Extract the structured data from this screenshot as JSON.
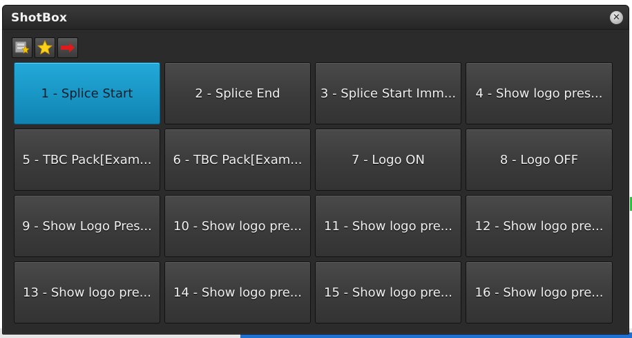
{
  "window": {
    "title": "ShotBox",
    "close_icon": "close-circle-icon"
  },
  "toolbar": {
    "buttons": [
      {
        "icon": "settings-sparkle-icon"
      },
      {
        "icon": "star-icon"
      },
      {
        "icon": "red-arrow-right-icon"
      }
    ]
  },
  "colors": {
    "active_button": "#1895c4",
    "window_bg": "#2b2b2b",
    "button_bg": "#3c3c3c"
  },
  "shots": [
    {
      "label": "1 - Splice Start",
      "active": true
    },
    {
      "label": "2 - Splice End"
    },
    {
      "label": "3 - Splice Start Imm..."
    },
    {
      "label": "4 - Show logo pres..."
    },
    {
      "label": "5 - TBC Pack[Exam..."
    },
    {
      "label": "6 - TBC Pack[Exam..."
    },
    {
      "label": "7 - Logo ON"
    },
    {
      "label": "8 - Logo OFF"
    },
    {
      "label": "9 - Show Logo Pres..."
    },
    {
      "label": "10 - Show logo pre..."
    },
    {
      "label": "11 - Show logo pre..."
    },
    {
      "label": "12 - Show logo pre..."
    },
    {
      "label": "13 - Show logo pre..."
    },
    {
      "label": "14 - Show logo pre..."
    },
    {
      "label": "15 - Show logo pre..."
    },
    {
      "label": "16 - Show logo pre..."
    }
  ]
}
